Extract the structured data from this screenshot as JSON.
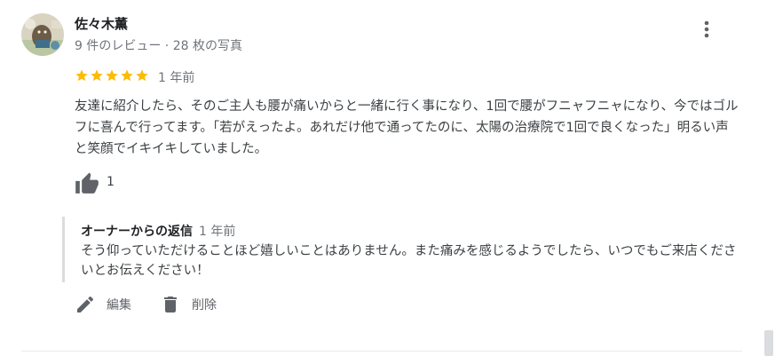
{
  "review": {
    "author": "佐々木薫",
    "meta": "9 件のレビュー · 28 枚の写真",
    "rating": 5,
    "rating_max": 5,
    "time": "1 年前",
    "text": "友達に紹介したら、そのご主人も腰が痛いからと一緒に行く事になり、1回で腰がフニャフニャになり、今ではゴルフに喜んで行ってます。「若がえったよ。あれだけ他で通ってたのに、太陽の治療院で1回で良くなった」明るい声と笑顔でイキイキしていました。",
    "like_count": "1"
  },
  "reply": {
    "owner_label": "オーナーからの返信",
    "time": "1 年前",
    "text": "そう仰っていただけることほど嬉しいことはありません。また痛みを感じるようでしたら、いつでもご来店くださいとお伝えください！"
  },
  "actions": {
    "edit_label": "編集",
    "delete_label": "削除"
  },
  "icons": {
    "more": "more-vert-icon",
    "thumb_up": "thumb-up-icon",
    "edit": "pencil-icon",
    "delete": "trash-icon",
    "star": "star-icon"
  },
  "colors": {
    "star": "#fbbc04",
    "icon": "#5f6368",
    "secondary_text": "#70757a",
    "reply_border": "#dadce0"
  }
}
